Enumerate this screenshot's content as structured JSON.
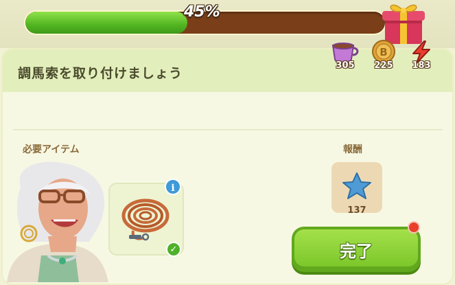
{
  "progress": {
    "percent_label": "45%",
    "fraction": 0.45
  },
  "reward_chest": {
    "icon": "gift-box-icon"
  },
  "task": {
    "title": "調馬索を取り付けましょう"
  },
  "resources": [
    {
      "icon": "tea-cup-icon",
      "count": "305"
    },
    {
      "icon": "coin-icon",
      "count": "225"
    },
    {
      "icon": "energy-bolt-icon",
      "count": "183"
    }
  ],
  "required": {
    "label": "必要アイテム",
    "item_icon": "lunge-rope-icon",
    "info_icon": "info-icon",
    "status_icon": "check-icon"
  },
  "reward": {
    "label": "報酬",
    "icon": "blue-star-icon",
    "count": "137"
  },
  "actions": {
    "complete_label": "完了"
  },
  "colors": {
    "progress_fill": "#52b521",
    "progress_track": "#7a3f19",
    "button": "#7cc72b"
  }
}
